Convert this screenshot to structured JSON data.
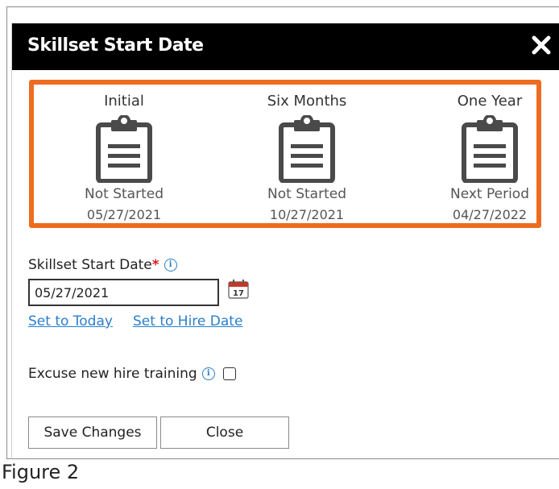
{
  "dialog": {
    "title": "Skillset Start Date",
    "close_label": "✕"
  },
  "periods": [
    {
      "title": "Initial",
      "status": "Not Started",
      "date": "05/27/2021"
    },
    {
      "title": "Six Months",
      "status": "Not Started",
      "date": "10/27/2021"
    },
    {
      "title": "One Year",
      "status": "Next Period",
      "date": "04/27/2022"
    }
  ],
  "form": {
    "start_date_label": "Skillset Start Date",
    "required_mark": "*",
    "start_date_value": "05/27/2021",
    "calendar_day": "17",
    "set_today_label": "Set to Today",
    "set_hire_label": "Set to Hire Date",
    "excuse_label": "Excuse new hire training",
    "excuse_checked": false,
    "info_glyph": "i"
  },
  "buttons": {
    "save_label": "Save Changes",
    "close_label": "Close"
  },
  "caption": "Figure 2",
  "colors": {
    "highlight_border": "#ee6c1f",
    "titlebar": "#000000",
    "link": "#2a7ecb",
    "required": "#d32020"
  }
}
